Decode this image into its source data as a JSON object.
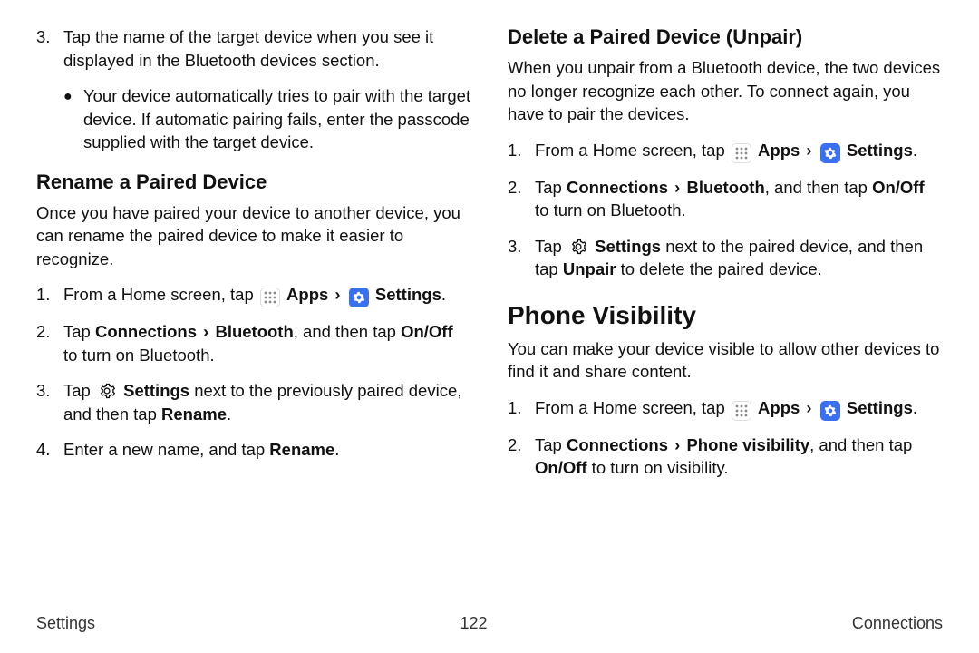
{
  "left": {
    "step3_num": "3.",
    "step3_txt_a": "Tap the name of the target device when you see it displayed in the Bluetooth devices section.",
    "bullet_txt": "Your device automatically tries to pair with the target device. If automatic pairing fails, enter the passcode supplied with the target device.",
    "h3": "Rename a Paired Device",
    "intro": "Once you have paired your device to another device, you can rename the paired device to make it easier to recognize.",
    "s1_num": "1.",
    "s1_pre": "From a Home screen, tap ",
    "s1_apps": "Apps",
    "s1_settings": "Settings",
    "s1_period": ".",
    "s2_num": "2.",
    "s2_a": "Tap ",
    "s2_b": "Connections",
    "s2_c": "Bluetooth",
    "s2_d": ", and then tap ",
    "s2_e": "On/Off",
    "s2_f": " to turn on Bluetooth.",
    "s3_num": "3.",
    "s3_a": "Tap ",
    "s3_b": "Settings",
    "s3_c": " next to the previously paired device, and then tap ",
    "s3_d": "Rename",
    "s3_e": ".",
    "s4_num": "4.",
    "s4_a": "Enter a new name, and tap ",
    "s4_b": "Rename",
    "s4_c": "."
  },
  "right": {
    "h3": "Delete a Paired Device (Unpair)",
    "intro": "When you unpair from a Bluetooth device, the two devices no longer recognize each other. To connect again, you have to pair the devices.",
    "s1_num": "1.",
    "s1_pre": "From a Home screen, tap ",
    "s1_apps": "Apps",
    "s1_settings": "Settings",
    "s1_period": ".",
    "s2_num": "2.",
    "s2_a": "Tap ",
    "s2_b": "Connections",
    "s2_c": "Bluetooth",
    "s2_d": ", and then tap ",
    "s2_e": "On/Off",
    "s2_f": " to turn on Bluetooth.",
    "s3_num": "3.",
    "s3_a": "Tap ",
    "s3_b": "Settings",
    "s3_c": " next to the paired device, and then tap ",
    "s3_d": "Unpair",
    "s3_e": " to delete the paired device.",
    "h2": "Phone Visibility",
    "pv_intro": "You can make your device visible to allow other devices to find it and share content.",
    "pv1_num": "1.",
    "pv1_pre": "From a Home screen, tap ",
    "pv1_apps": "Apps",
    "pv1_settings": "Settings",
    "pv1_period": ".",
    "pv2_num": "2.",
    "pv2_a": "Tap ",
    "pv2_b": "Connections",
    "pv2_c": "Phone visibility",
    "pv2_d": ", and then tap ",
    "pv2_e": "On/Off",
    "pv2_f": " to turn on visibility."
  },
  "footer": {
    "left": "Settings",
    "center": "122",
    "right": "Connections"
  },
  "glyph": {
    "chev": "›",
    "bullet": "●"
  }
}
